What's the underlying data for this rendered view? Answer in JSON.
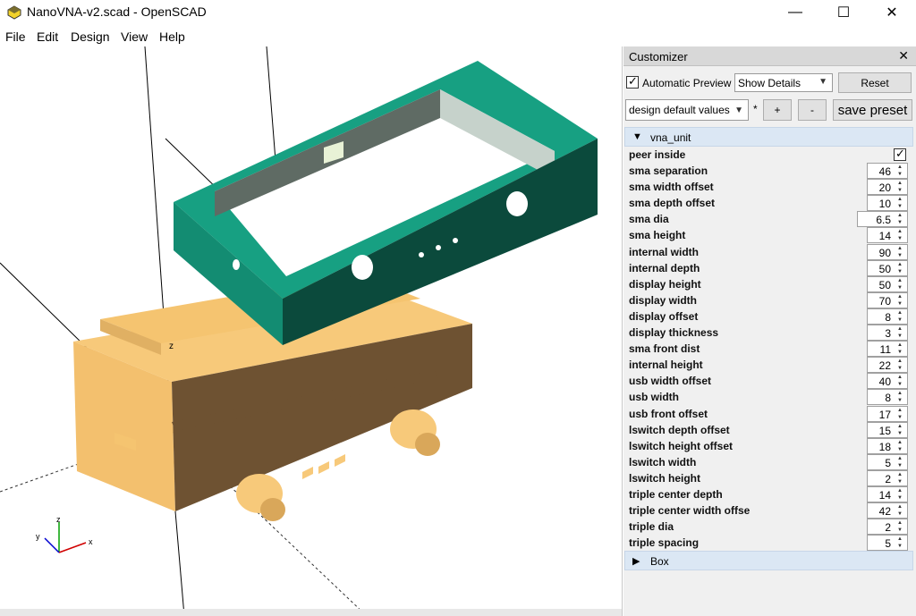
{
  "window": {
    "title": "NanoVNA-v2.scad - OpenSCAD",
    "minimize": "—",
    "maximize": "☐",
    "close": "✕"
  },
  "menu": [
    "File",
    "Edit",
    "Design",
    "View",
    "Help"
  ],
  "viewport": {
    "axis_label_z": "z",
    "gizmo_x": "x",
    "gizmo_y": "y",
    "gizmo_z": "z",
    "colors": {
      "lid": "#16967b",
      "lid_dark": "#0a4a3c",
      "base": "#f5c46e",
      "base_dark": "#6b4f2c"
    }
  },
  "customizer": {
    "title": "Customizer",
    "close": "✕",
    "automatic_preview_label": "Automatic Preview",
    "automatic_preview_checked": true,
    "details_select": "Show Details",
    "reset_label": "Reset",
    "preset_select": "design default values",
    "modified_marker": "*",
    "plus_label": "+",
    "minus_label": "-",
    "save_preset_label": "save preset",
    "group_vna_unit": "vna_unit",
    "group_box": "Box",
    "peer_inside_label": "peer inside",
    "peer_inside_checked": true,
    "params": [
      {
        "label": "sma separation",
        "value": "46"
      },
      {
        "label": "sma width offset",
        "value": "20"
      },
      {
        "label": "sma depth offset",
        "value": "10"
      },
      {
        "label": "sma dia",
        "value": "6.5"
      },
      {
        "label": "sma height",
        "value": "14"
      },
      {
        "label": "internal width",
        "value": "90"
      },
      {
        "label": "internal depth",
        "value": "50"
      },
      {
        "label": "display height",
        "value": "50"
      },
      {
        "label": "display width",
        "value": "70"
      },
      {
        "label": "display offset",
        "value": "8"
      },
      {
        "label": "display thickness",
        "value": "3"
      },
      {
        "label": "sma front dist",
        "value": "11"
      },
      {
        "label": "internal height",
        "value": "22"
      },
      {
        "label": "usb width offset",
        "value": "40"
      },
      {
        "label": "usb width",
        "value": "8"
      },
      {
        "label": "usb front offset",
        "value": "17"
      },
      {
        "label": "lswitch depth offset",
        "value": "15"
      },
      {
        "label": "lswitch height offset",
        "value": "18"
      },
      {
        "label": "lswitch width",
        "value": "5"
      },
      {
        "label": "lswitch height",
        "value": "2"
      },
      {
        "label": "triple center depth",
        "value": "14"
      },
      {
        "label": "triple center width offse",
        "value": "42"
      },
      {
        "label": "triple dia",
        "value": "2"
      },
      {
        "label": "triple spacing",
        "value": "5"
      }
    ]
  }
}
